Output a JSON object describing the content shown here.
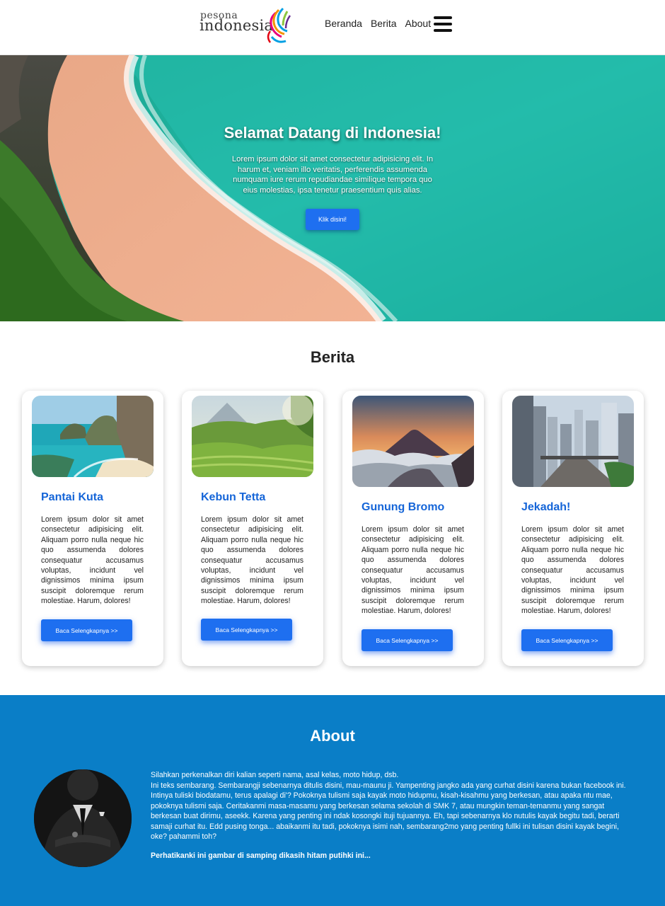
{
  "header": {
    "logo_small": "pesona",
    "logo_big": "indonesia",
    "nav": [
      "Beranda",
      "Berita",
      "About"
    ]
  },
  "hero": {
    "title": "Selamat Datang di Indonesia!",
    "text": "Lorem ipsum dolor sit amet consectetur adipisicing elit. In harum et, veniam illo veritatis, perferendis assumenda numquam iure rerum repudiandae similique tempora quo eius molestias, ipsa tenetur praesentium quis alias.",
    "button": "Klik disini!"
  },
  "berita": {
    "title": "Berita",
    "cards": [
      {
        "title": "Pantai Kuta",
        "text": "Lorem ipsum dolor sit amet consectetur adipisicing elit. Aliquam porro nulla neque hic quo assumenda dolores consequatur accusamus voluptas, incidunt vel dignissimos minima ipsum suscipit doloremque rerum molestiae. Harum, dolores!",
        "button": "Baca Selengkapnya >>"
      },
      {
        "title": "Kebun Tetta",
        "text": "Lorem ipsum dolor sit amet consectetur adipisicing elit. Aliquam porro nulla neque hic quo assumenda dolores consequatur accusamus voluptas, incidunt vel dignissimos minima ipsum suscipit doloremque rerum molestiae. Harum, dolores!",
        "button": "Baca Selengkapnya >>"
      },
      {
        "title": "Gunung Bromo",
        "text": "Lorem ipsum dolor sit amet consectetur adipisicing elit. Aliquam porro nulla neque hic quo assumenda dolores consequatur accusamus voluptas, incidunt vel dignissimos minima ipsum suscipit doloremque rerum molestiae. Harum, dolores!",
        "button": "Baca Selengkapnya >>"
      },
      {
        "title": "Jekadah!",
        "text": "Lorem ipsum dolor sit amet consectetur adipisicing elit. Aliquam porro nulla neque hic quo assumenda dolores consequatur accusamus voluptas, incidunt vel dignissimos minima ipsum suscipit doloremque rerum molestiae. Harum, dolores!",
        "button": "Baca Selengkapnya >>"
      }
    ]
  },
  "about": {
    "title": "About",
    "line1": "Silahkan perkenalkan diri kalian seperti nama, asal kelas, moto hidup, dsb.",
    "line2": "Ini teks sembarang. Sembarangji sebenarnya ditulis disini, mau-maunu ji. Yampenting jangko ada yang curhat disini karena bukan facebook ini. Intinya tuliski biodatamu, terus apalagi di'? Pokoknya tulismi saja kayak moto hidupmu, kisah-kisahmu yang berkesan, atau apaka ntu mae, pokoknya tulismi saja. Ceritakanmi masa-masamu yang berkesan selama sekolah di SMK 7, atau mungkin teman-temanmu yang sangat berkesan buat dirimu, aseekk. Karena yang penting ini ndak kosongki ituji tujuannya. Eh, tapi sebenarnya klo nutulis kayak begitu tadi, berarti samaji curhat itu. Edd pusing tonga... abaikanmi itu tadi, pokoknya isimi nah, sembarang2mo yang penting fullki ini tulisan disini kayak begini, oke? pahammi toh?",
    "note": "Perhatikanki ini gambar di samping dikasih hitam putihki ini..."
  },
  "colors": {
    "accent": "#1e6ff0",
    "title_blue": "#1565d8",
    "about_bg": "#0a7ec7"
  }
}
